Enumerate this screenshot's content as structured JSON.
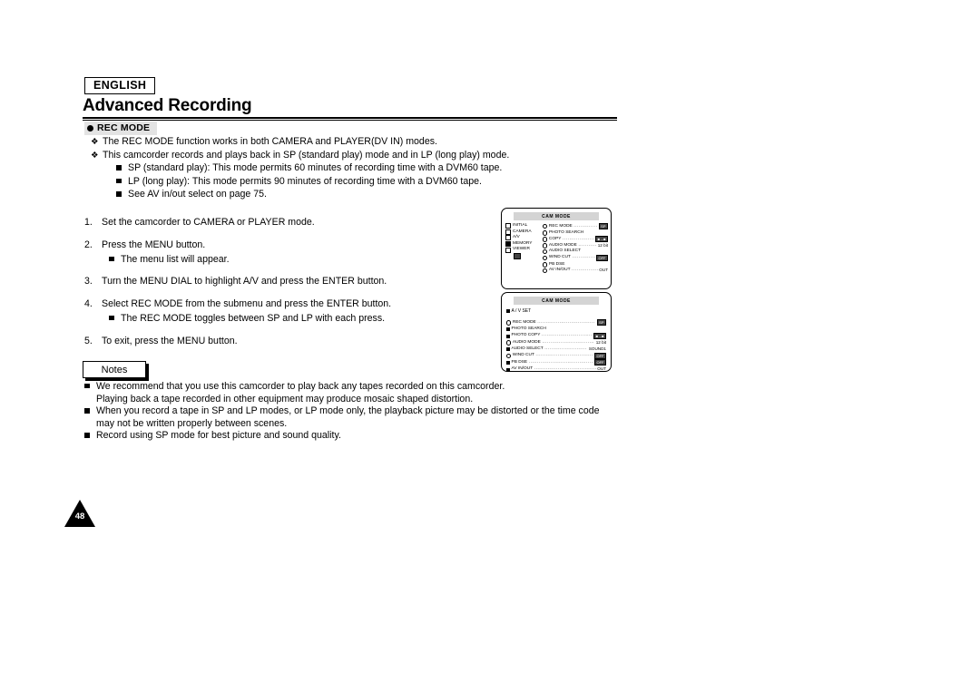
{
  "header": {
    "language_badge": "ENGLISH",
    "doc_title": "Advanced Recording",
    "section_heading": "REC MODE"
  },
  "intro_bullets": [
    {
      "marker": "diamond",
      "indent": 1,
      "text": "The REC MODE function works in both CAMERA and PLAYER(DV IN) modes."
    },
    {
      "marker": "diamond",
      "indent": 1,
      "text": "This camcorder records and plays back in SP (standard play) mode and in LP (long play) mode."
    },
    {
      "marker": "square",
      "indent": 2,
      "text": "SP (standard play): This mode permits 60 minutes of recording time with a DVM60 tape."
    },
    {
      "marker": "square",
      "indent": 2,
      "text": "LP (long play): This mode permits 90 minutes of recording time with a DVM60 tape."
    },
    {
      "marker": "square",
      "indent": 2,
      "text": "See AV in/out select on page 75."
    }
  ],
  "steps": [
    {
      "num": "1.",
      "text": "Set the camcorder to CAMERA or PLAYER mode.",
      "sub": []
    },
    {
      "num": "2.",
      "text": "Press the MENU button.",
      "sub": [
        "The menu list will appear."
      ]
    },
    {
      "num": "3.",
      "text": "Turn the MENU DIAL to highlight A/V and press the ENTER button.",
      "sub": []
    },
    {
      "num": "4.",
      "text": "Select REC MODE from the submenu and press the ENTER button.",
      "sub": [
        "The REC MODE toggles between SP and LP with each press."
      ]
    },
    {
      "num": "5.",
      "text": "To exit, press the MENU button.",
      "sub": []
    }
  ],
  "notes": {
    "tab_label": "Notes",
    "items": [
      {
        "text": "We recommend that you use this camcorder to play back any tapes recorded on this camcorder.",
        "continuation": "Playing back a tape recorded in other equipment may produce mosaic shaped distortion."
      },
      {
        "text": "When you record a tape in SP and LP modes, or LP mode only, the playback picture may be distorted or the time code",
        "continuation": "may not be written properly between scenes."
      },
      {
        "text": "Record using SP mode for best picture and sound quality.",
        "continuation": ""
      }
    ]
  },
  "page_number": "48",
  "lcd_screen_1": {
    "title": "CAM MODE",
    "left_menu": [
      {
        "label": "INITIAL",
        "icon": "box-outline",
        "selected": false
      },
      {
        "label": "CAMERA",
        "icon": "box-outline",
        "selected": false
      },
      {
        "label": "A/V",
        "icon": "box-outline",
        "selected": false
      },
      {
        "label": "MEMORY",
        "icon": "box-filled",
        "selected": true
      },
      {
        "label": "VIEWER",
        "icon": "box-outline",
        "selected": false
      }
    ],
    "right_menu": [
      {
        "label": "REC MODE",
        "value": "SP",
        "value_type": "chip",
        "icon": "dot-outline"
      },
      {
        "label": "PHOTO SEARCH",
        "value": "",
        "value_type": "none",
        "icon": "dot-outline"
      },
      {
        "label": "COPY",
        "value": "■→■",
        "value_type": "chip",
        "icon": "dot-outline"
      },
      {
        "label": "AUDIO MODE",
        "value": "12 bit",
        "value_type": "text",
        "icon": "dot-outline"
      },
      {
        "label": "AUDIO SELECT",
        "value": "",
        "value_type": "none",
        "icon": "dot-outline"
      },
      {
        "label": "WIND CUT",
        "value": "OFF",
        "value_type": "chip",
        "icon": "dot-outline"
      },
      {
        "label": "PB DSE",
        "value": "",
        "value_type": "none",
        "icon": "dot-outline"
      },
      {
        "label": "AV IN/OUT",
        "value": "OUT",
        "value_type": "text",
        "icon": "dot-outline"
      }
    ]
  },
  "lcd_screen_2": {
    "title": "CAM MODE",
    "submenu_label": "A / V SET",
    "menu": [
      {
        "label": "REC MODE",
        "value": "SP",
        "value_type": "chip",
        "icon": "dot-outline"
      },
      {
        "label": "PHOTO SEARCH",
        "value": "",
        "value_type": "none",
        "icon": "sq-filled"
      },
      {
        "label": "PHOTO COPY",
        "value": "■→■",
        "value_type": "chip",
        "icon": "sq-filled"
      },
      {
        "label": "AUDIO MODE",
        "value": "12 bit",
        "value_type": "text",
        "icon": "dot-outline"
      },
      {
        "label": "AUDIO SELECT",
        "value": "SOUND1",
        "value_type": "text",
        "icon": "sq-filled"
      },
      {
        "label": "WIND CUT",
        "value": "OFF",
        "value_type": "chip",
        "icon": "dot-outline"
      },
      {
        "label": "PB DSE",
        "value": "OFF",
        "value_type": "chip",
        "icon": "sq-filled"
      },
      {
        "label": "AV IN/OUT",
        "value": "OUT",
        "value_type": "text",
        "icon": "sq-filled"
      }
    ]
  }
}
